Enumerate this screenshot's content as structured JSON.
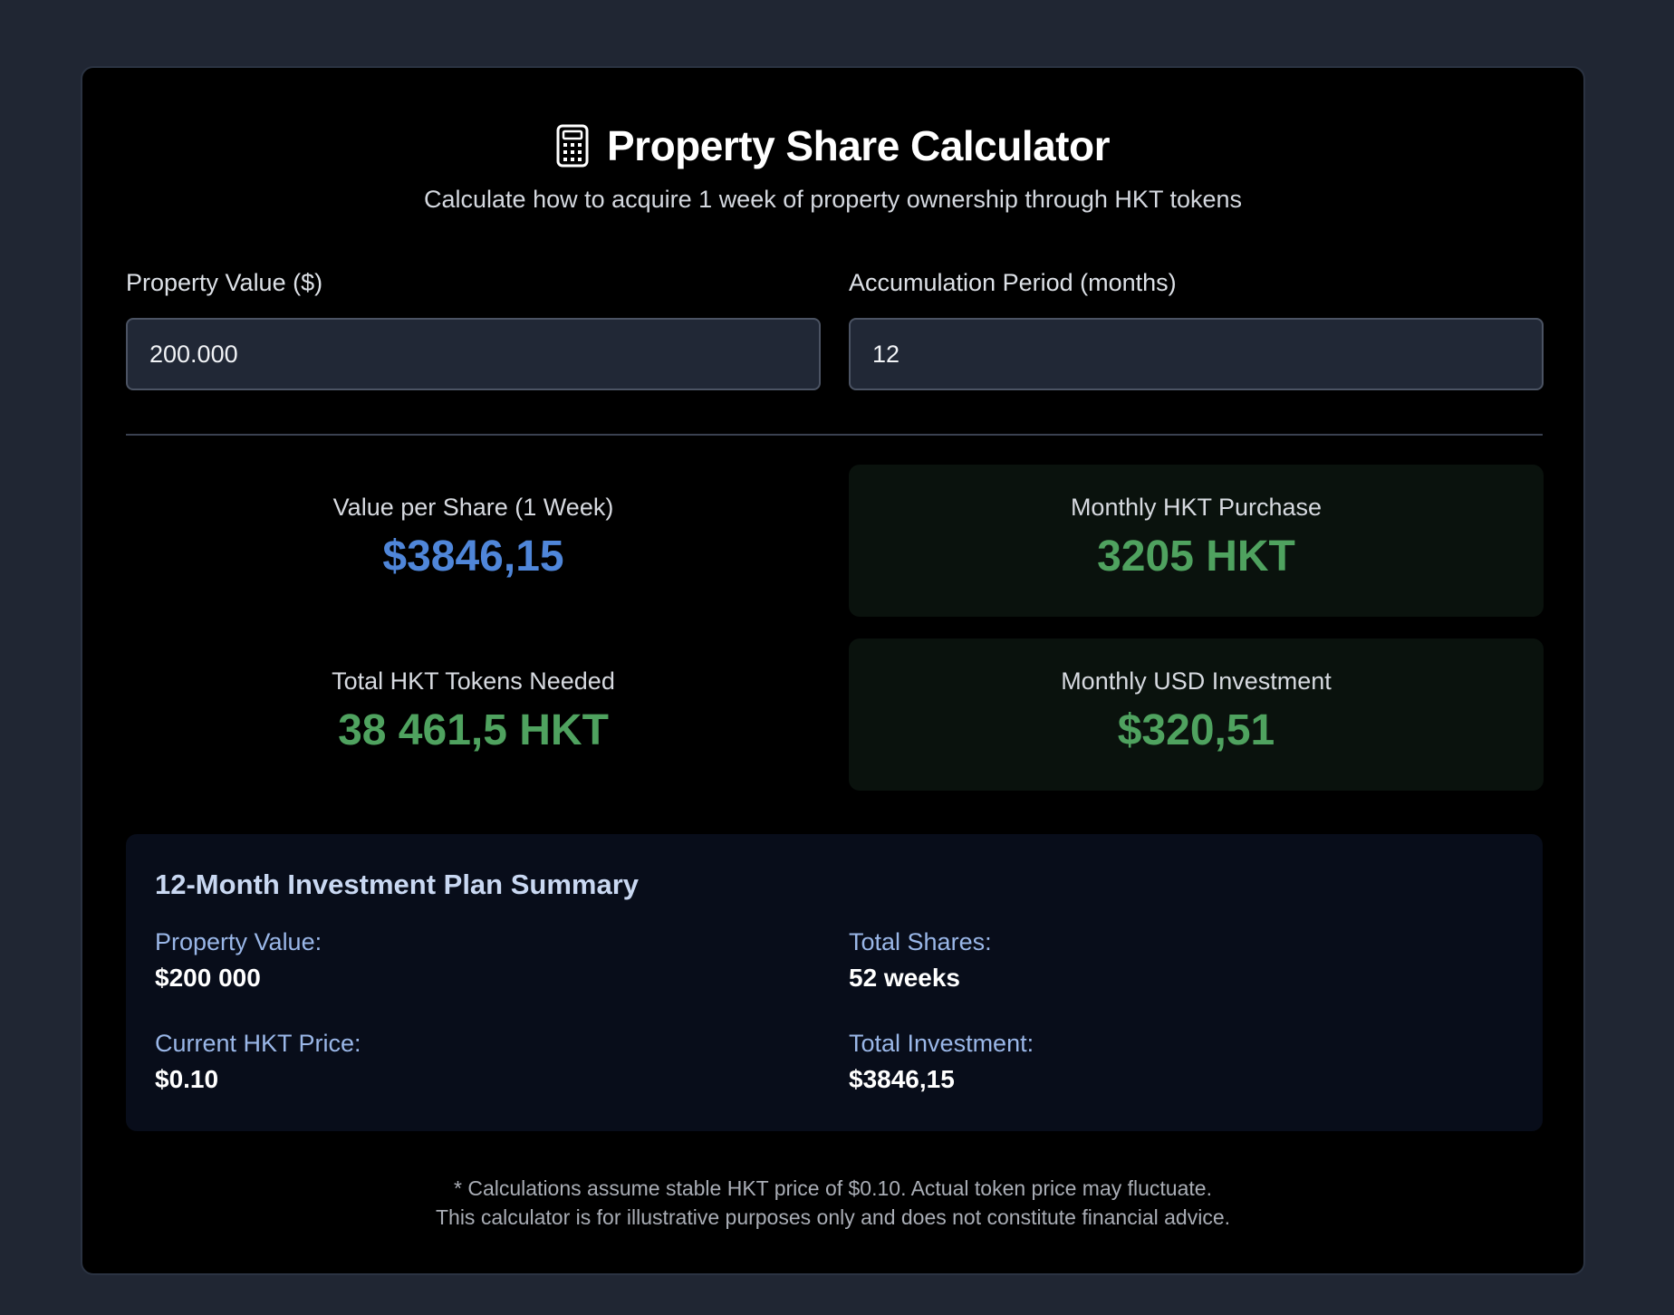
{
  "header": {
    "title": "Property Share Calculator",
    "subtitle": "Calculate how to acquire 1 week of property ownership through HKT tokens",
    "icon": "calculator-icon"
  },
  "inputs": {
    "property_value": {
      "label": "Property Value ($)",
      "value": "200.000"
    },
    "accumulation_period": {
      "label": "Accumulation Period (months)",
      "value": "12"
    }
  },
  "results": {
    "value_per_share": {
      "label": "Value per Share (1 Week)",
      "value": "$3846,15"
    },
    "monthly_hkt_purchase": {
      "label": "Monthly HKT Purchase",
      "value": "3205 HKT"
    },
    "total_hkt_needed": {
      "label": "Total HKT Tokens Needed",
      "value": "38 461,5 HKT"
    },
    "monthly_usd_investment": {
      "label": "Monthly USD Investment",
      "value": "$320,51"
    }
  },
  "summary": {
    "title": "12-Month Investment Plan Summary",
    "items": [
      {
        "label": "Property Value:",
        "value": "$200 000"
      },
      {
        "label": "Total Shares:",
        "value": "52 weeks"
      },
      {
        "label": "Current HKT Price:",
        "value": "$0.10"
      },
      {
        "label": "Total Investment:",
        "value": "$3846,15"
      }
    ]
  },
  "disclaimer": {
    "line1": "* Calculations assume stable HKT price of $0.10. Actual token price may fluctuate.",
    "line2": "This calculator is for illustrative purposes only and does not constitute financial advice."
  },
  "colors": {
    "page_bg": "#202633",
    "card_bg": "#000000",
    "accent_blue": "#4f86d9",
    "accent_green": "#4fa25f",
    "summary_label": "#9ab7e8"
  }
}
